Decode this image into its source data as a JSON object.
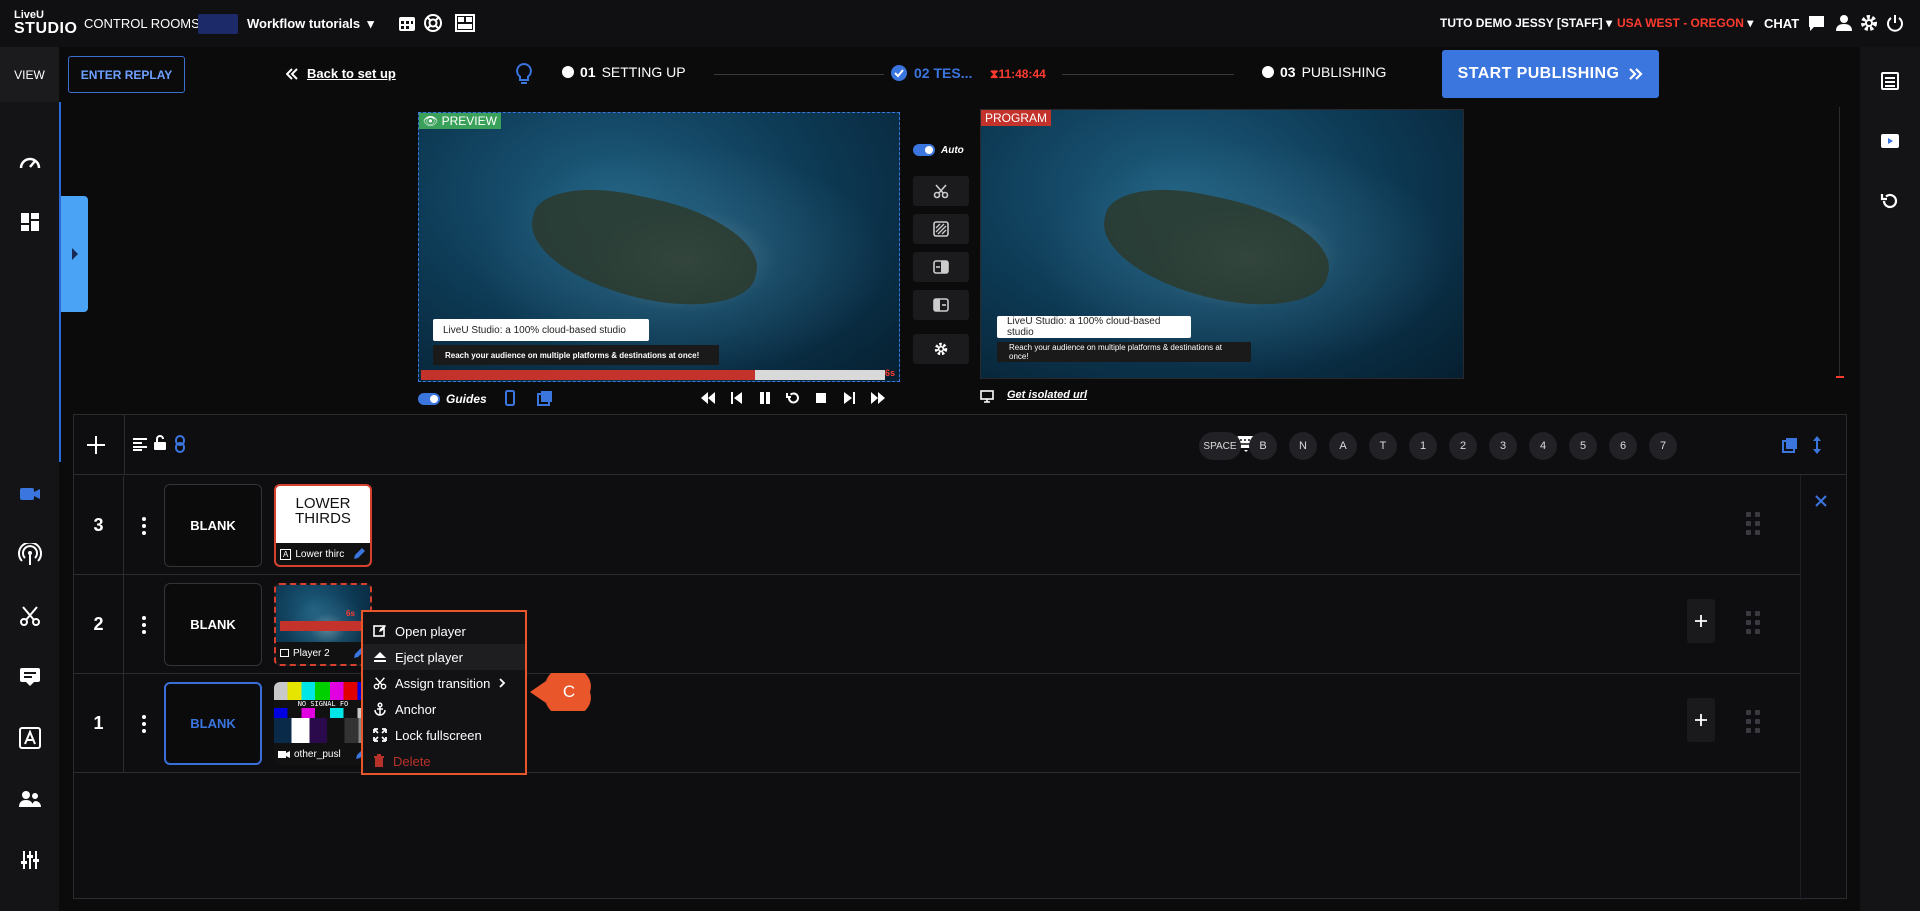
{
  "topbar": {
    "logo_top": "LiveU",
    "logo_bottom": "STUDIO",
    "control_rooms": "CONTROL ROOMS",
    "workflow": "Workflow tutorials",
    "user": "TUTO DEMO JESSY [STAFF]",
    "region": "USA WEST - OREGON",
    "chat": "CHAT"
  },
  "sidebar": {
    "view_label": "VIEW"
  },
  "header": {
    "replay_button": "ENTER REPLAY",
    "back_link": "Back to set up",
    "step1_num": "01",
    "step1_label": "SETTING UP",
    "step2_label": "02 TES...",
    "timer": "11:48:44",
    "step3_num": "03",
    "step3_label": "PUBLISHING",
    "publish_button": "START PUBLISHING"
  },
  "preview": {
    "tag": "PREVIEW",
    "lower_third_title": "LiveU Studio: a 100% cloud-based studio",
    "lower_third_sub": "Reach your audience on multiple platforms & destinations at once!",
    "countdown": "6s",
    "progress": 0.72,
    "guides_label": "Guides"
  },
  "program": {
    "tag": "PROGRAM",
    "lower_third_title": "LiveU Studio: a 100% cloud-based studio",
    "lower_third_sub": "Reach your audience on multiple platforms & destinations at once!",
    "isolated_link": "Get isolated url"
  },
  "transition": {
    "auto_label": "Auto"
  },
  "toolbar": {
    "shortcuts": [
      "SPACE",
      "B",
      "N",
      "A",
      "T",
      "1",
      "2",
      "3",
      "4",
      "5",
      "6",
      "7"
    ]
  },
  "layers": [
    {
      "num": "3",
      "blank": "BLANK",
      "source_title_1": "LOWER",
      "source_title_2": "THIRDS",
      "source_label": "Lower thirc"
    },
    {
      "num": "2",
      "blank": "BLANK",
      "source_label": "Player 2",
      "countdown": "6s"
    },
    {
      "num": "1",
      "blank": "BLANK",
      "source_label": "other_pusl",
      "signal_text": "NO SIGNAL FO"
    }
  ],
  "context_menu": {
    "items": [
      "Open player",
      "Eject player",
      "Assign transition",
      "Anchor",
      "Lock fullscreen",
      "Delete"
    ]
  },
  "callout": {
    "label": "C",
    "color": "#e8562a"
  },
  "colors": {
    "accent": "#3b75de",
    "danger": "#ff3b2f",
    "highlight": "#e8562a"
  }
}
